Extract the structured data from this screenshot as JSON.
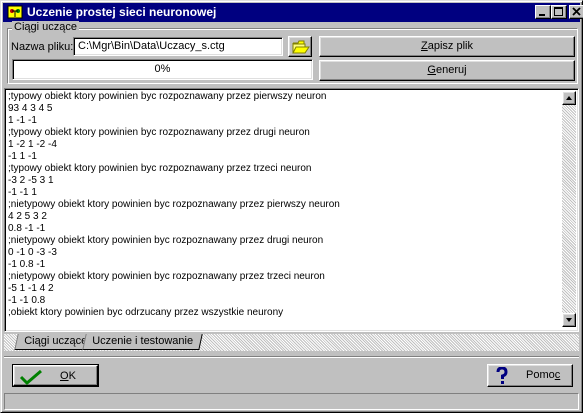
{
  "window": {
    "title": "Uczenie prostej sieci neuronowej",
    "icon": "app-icon",
    "controls": [
      "minimize-icon",
      "maximize-icon",
      "close-icon"
    ]
  },
  "group": {
    "legend": "Ciągi uczące"
  },
  "file": {
    "label": "Nazwa pliku:",
    "value": "C:\\Mgr\\Bin\\Data\\Uczacy_s.ctg",
    "browse_icon": "folder-open-icon"
  },
  "buttons": {
    "save": {
      "prefix": "",
      "hotkey": "Z",
      "rest": "apisz plik"
    },
    "generate": {
      "prefix": "",
      "hotkey": "G",
      "rest": "eneruj"
    },
    "ok": {
      "prefix": "",
      "hotkey": "O",
      "rest": "K",
      "icon": "checkmark-icon"
    },
    "help": {
      "prefix": "Pomo",
      "hotkey": "c",
      "rest": "",
      "icon": "question-icon"
    }
  },
  "progress": {
    "text": "0%",
    "value": 0
  },
  "content": {
    "lines": [
      ";typowy obiekt ktory powinien byc rozpoznawany przez pierwszy neuron",
      "93 4 3 4 5",
      "1 -1 -1",
      ";typowy obiekt ktory powinien byc rozpoznawany przez drugi neuron",
      "1 -2 1 -2 -4",
      "-1 1 -1",
      ";typowy obiekt ktory powinien byc rozpoznawany przez trzeci neuron",
      "-3 2 -5 3 1",
      "-1 -1 1",
      ";nietypowy obiekt ktory powinien byc rozpoznawany przez pierwszy neuron",
      "4 2 5 3 2",
      "0.8 -1 -1",
      ";nietypowy obiekt ktory powinien byc rozpoznawany przez drugi neuron",
      "0 -1 0 -3 -3",
      "-1 0.8 -1",
      ";nietypowy obiekt ktory powinien byc rozpoznawany przez trzeci neuron",
      "-5 1 -1 4 2",
      "-1 -1 0.8",
      ";obiekt ktory powinien byc odrzucany przez wszystkie neurony"
    ]
  },
  "tabs": [
    {
      "label": "Ciągi uczące",
      "active": true
    },
    {
      "label": "Uczenie i testowanie",
      "active": false
    }
  ],
  "colors": {
    "titlebar": "#000080",
    "face": "#c0c0c0",
    "check": "#008000",
    "help": "#000080"
  }
}
